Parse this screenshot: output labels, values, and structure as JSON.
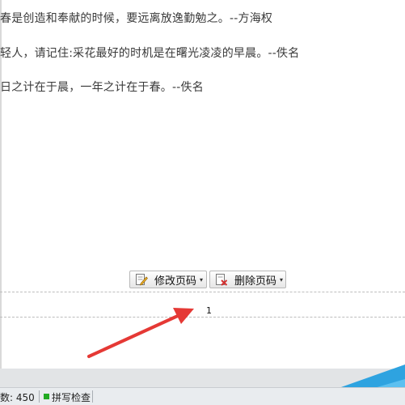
{
  "document": {
    "lines": [
      "春是创造和奉献的时候，要远离放逸勤勉之。--方海权",
      "轻人，请记住:采花最好的时机是在曙光凌凌的早晨。--佚名",
      "日之计在于晨，一年之计在于春。--佚名"
    ]
  },
  "footer_toolbar": {
    "edit_label": "修改页码",
    "delete_label": "删除页码"
  },
  "footer": {
    "page_number": "1"
  },
  "status_bar": {
    "word_count": "数: 450",
    "spell_check": "拼写检查"
  },
  "colors": {
    "arrow": "#e53935",
    "spell_indicator": "#22aa22",
    "corner_blue": "#2ea3e0"
  },
  "icons": [
    "edit-page-number-icon",
    "delete-page-number-icon",
    "dropdown-caret-icon"
  ]
}
